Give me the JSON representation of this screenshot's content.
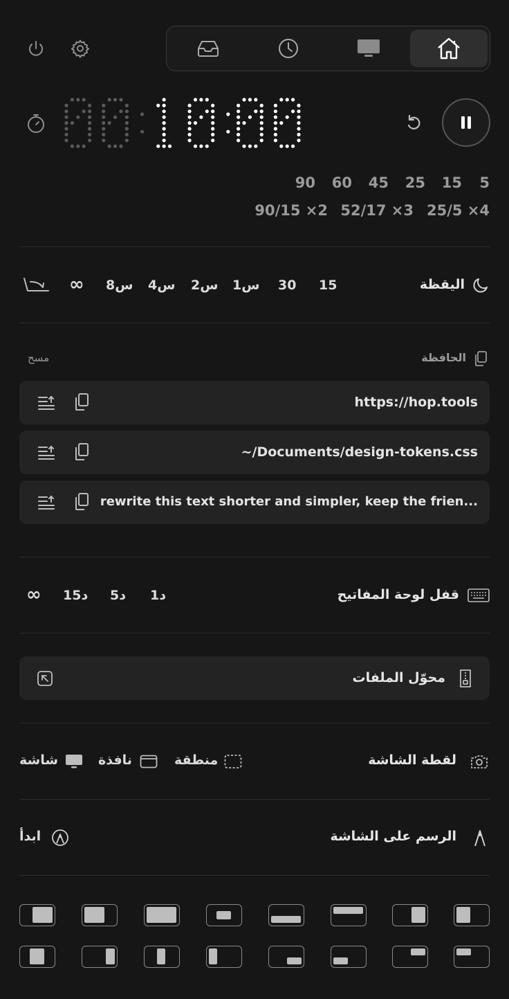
{
  "tabs": [
    {
      "icon": "inbox-tray-icon"
    },
    {
      "icon": "clock-icon"
    },
    {
      "icon": "monitor-icon"
    },
    {
      "icon": "home-icon",
      "active": true
    }
  ],
  "timer": {
    "display": "00:10:00",
    "presets_row1": [
      "5",
      "15",
      "25",
      "45",
      "60",
      "90"
    ],
    "presets_row2": [
      "25/5 ×4",
      "52/17 ×3",
      "90/15 ×2"
    ]
  },
  "awake": {
    "label": "اليقظة",
    "options": [
      "15",
      "30",
      "1س",
      "2س",
      "4س",
      "8س",
      "∞"
    ]
  },
  "clipboard": {
    "label": "الحافظة",
    "clear_label": "مسح",
    "items": [
      "https://hop.tools",
      "~/Documents/design-tokens.css",
      "rewrite this text shorter and simpler, keep the frien..."
    ]
  },
  "keyboard_lock": {
    "label": "قفل لوحة المفاتيح",
    "options": [
      "1د",
      "5د",
      "15د",
      "∞"
    ]
  },
  "file_converter": {
    "label": "محوّل الملفات"
  },
  "screenshot": {
    "label": "لقطة الشاشة",
    "options": [
      "منطقة",
      "نافذة",
      "شاشة"
    ]
  },
  "draw": {
    "label": "الرسم على الشاشة",
    "start_label": "ابدأ"
  },
  "colors": {
    "background": "#161616",
    "panel": "#232323",
    "accent_white": "#ffffff"
  }
}
